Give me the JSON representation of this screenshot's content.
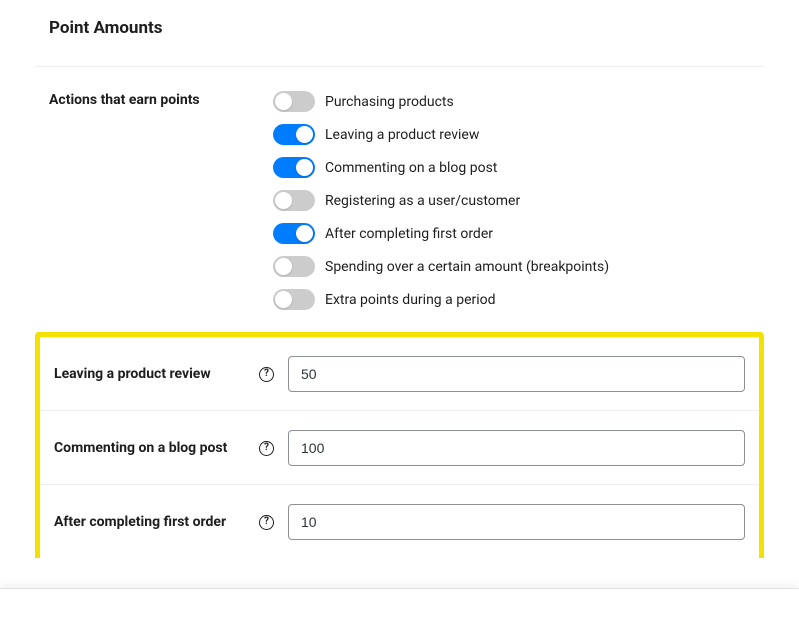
{
  "section": {
    "title": "Point Amounts",
    "actions_label": "Actions that earn points"
  },
  "toggles": [
    {
      "label": "Purchasing products",
      "on": false
    },
    {
      "label": "Leaving a product review",
      "on": true
    },
    {
      "label": "Commenting on a blog post",
      "on": true
    },
    {
      "label": "Registering as a user/customer",
      "on": false
    },
    {
      "label": "After completing first order",
      "on": true
    },
    {
      "label": "Spending over a certain amount (breakpoints)",
      "on": false
    },
    {
      "label": "Extra points during a period",
      "on": false
    }
  ],
  "inputs": [
    {
      "label": "Leaving a product review",
      "value": "50"
    },
    {
      "label": "Commenting on a blog post",
      "value": "100"
    },
    {
      "label": "After completing first order",
      "value": "10"
    }
  ]
}
